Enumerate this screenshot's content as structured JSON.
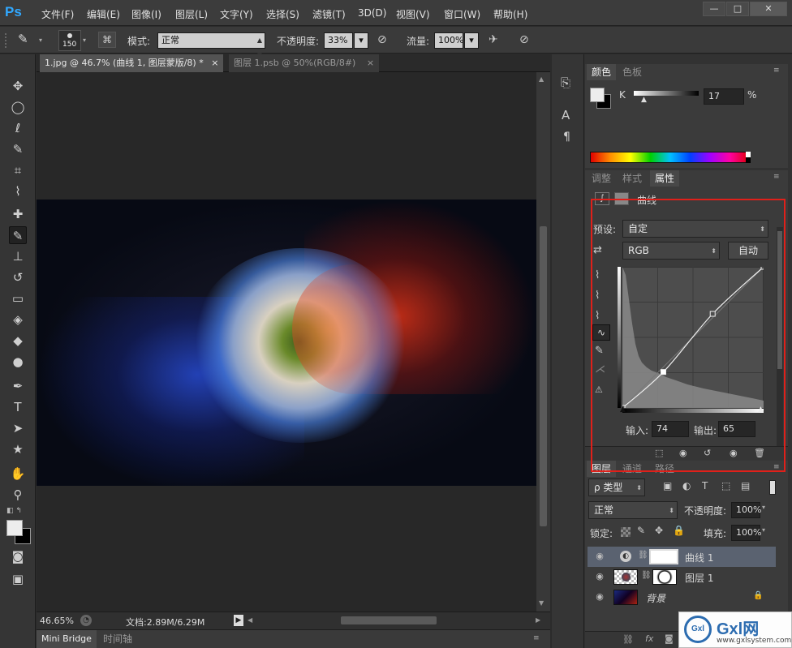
{
  "app": {
    "logo": "Ps"
  },
  "menu": [
    "文件(F)",
    "编辑(E)",
    "图像(I)",
    "图层(L)",
    "文字(Y)",
    "选择(S)",
    "滤镜(T)",
    "3D(D)",
    "视图(V)",
    "窗口(W)",
    "帮助(H)"
  ],
  "window_controls": {
    "minimize": "—",
    "maximize": "□",
    "close": "✕"
  },
  "options": {
    "brush_size": "150",
    "mode_label": "模式:",
    "mode_value": "正常",
    "opacity_label": "不透明度:",
    "opacity_value": "33%",
    "flow_label": "流量:",
    "flow_value": "100%"
  },
  "tabs": [
    {
      "label": "1.jpg @ 46.7% (曲线 1, 图层蒙版/8) *",
      "close": "×"
    },
    {
      "label": "图层 1.psb @ 50%(RGB/8#)",
      "close": "×"
    }
  ],
  "status": {
    "zoom": "46.65%",
    "doc": "文档:2.89M/6.29M"
  },
  "bottom_tabs": [
    "Mini Bridge",
    "时间轴"
  ],
  "color_panel": {
    "tabs": [
      "颜色",
      "色板"
    ],
    "channel": "K",
    "value": "17",
    "unit": "%"
  },
  "props_panel": {
    "tabs": [
      "调整",
      "样式",
      "属性"
    ],
    "title": "曲线",
    "preset_label": "预设:",
    "preset_value": "自定",
    "channel_value": "RGB",
    "auto_label": "自动",
    "input_label": "输入:",
    "input_value": "74",
    "output_label": "输出:",
    "output_value": "65"
  },
  "curve_points": [
    [
      0,
      0
    ],
    [
      74,
      65
    ],
    [
      163,
      170
    ],
    [
      255,
      255
    ]
  ],
  "layers_panel": {
    "tabs": [
      "图层",
      "通道",
      "路径"
    ],
    "filter_label": "ρ 类型",
    "blend": "正常",
    "opacity_label": "不透明度:",
    "opacity_value": "100%",
    "lock_label": "锁定:",
    "fill_label": "填充:",
    "fill_value": "100%",
    "layers": [
      {
        "name": "曲线 1"
      },
      {
        "name": "图层 1"
      },
      {
        "name": "背景"
      }
    ]
  },
  "watermark": {
    "brand": "Gxl网",
    "url": "www.gxlsystem.com"
  },
  "colors": {
    "accent_red": "#e0201a",
    "ps_blue": "#31a8ff"
  }
}
